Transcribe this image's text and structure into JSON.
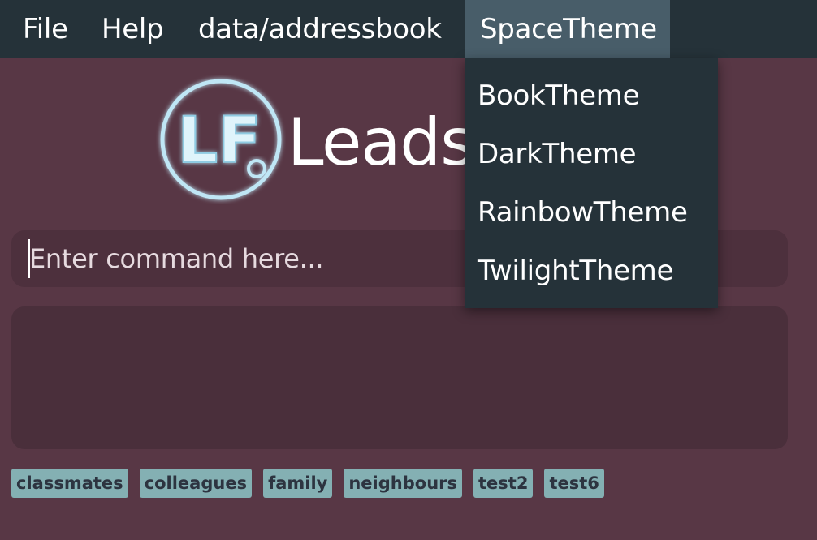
{
  "menubar": {
    "items": [
      {
        "label": "File"
      },
      {
        "label": "Help"
      },
      {
        "label": "data/addressbook"
      },
      {
        "label": "SpaceTheme"
      }
    ]
  },
  "theme_menu": {
    "options": [
      {
        "label": "BookTheme"
      },
      {
        "label": "DarkTheme"
      },
      {
        "label": "RainbowTheme"
      },
      {
        "label": "TwilightTheme"
      }
    ]
  },
  "header": {
    "logo_icon": "lf-logo-icon",
    "logo_text": "LF",
    "title": "Leads"
  },
  "command": {
    "placeholder": "Enter command here...",
    "value": ""
  },
  "result": {
    "text": ""
  },
  "tags": [
    {
      "label": "classmates"
    },
    {
      "label": "colleagues"
    },
    {
      "label": "family"
    },
    {
      "label": "neighbours"
    },
    {
      "label": "test2"
    },
    {
      "label": "test6"
    }
  ],
  "colors": {
    "background": "#583745",
    "menubar": "#253239",
    "menu_active": "#485d69",
    "command_box": "#4d303d",
    "result_box": "#4a2f3b",
    "tag": "#84b0b3",
    "tag_text": "#2d3440",
    "logo_accent": "#bfe6f5"
  }
}
